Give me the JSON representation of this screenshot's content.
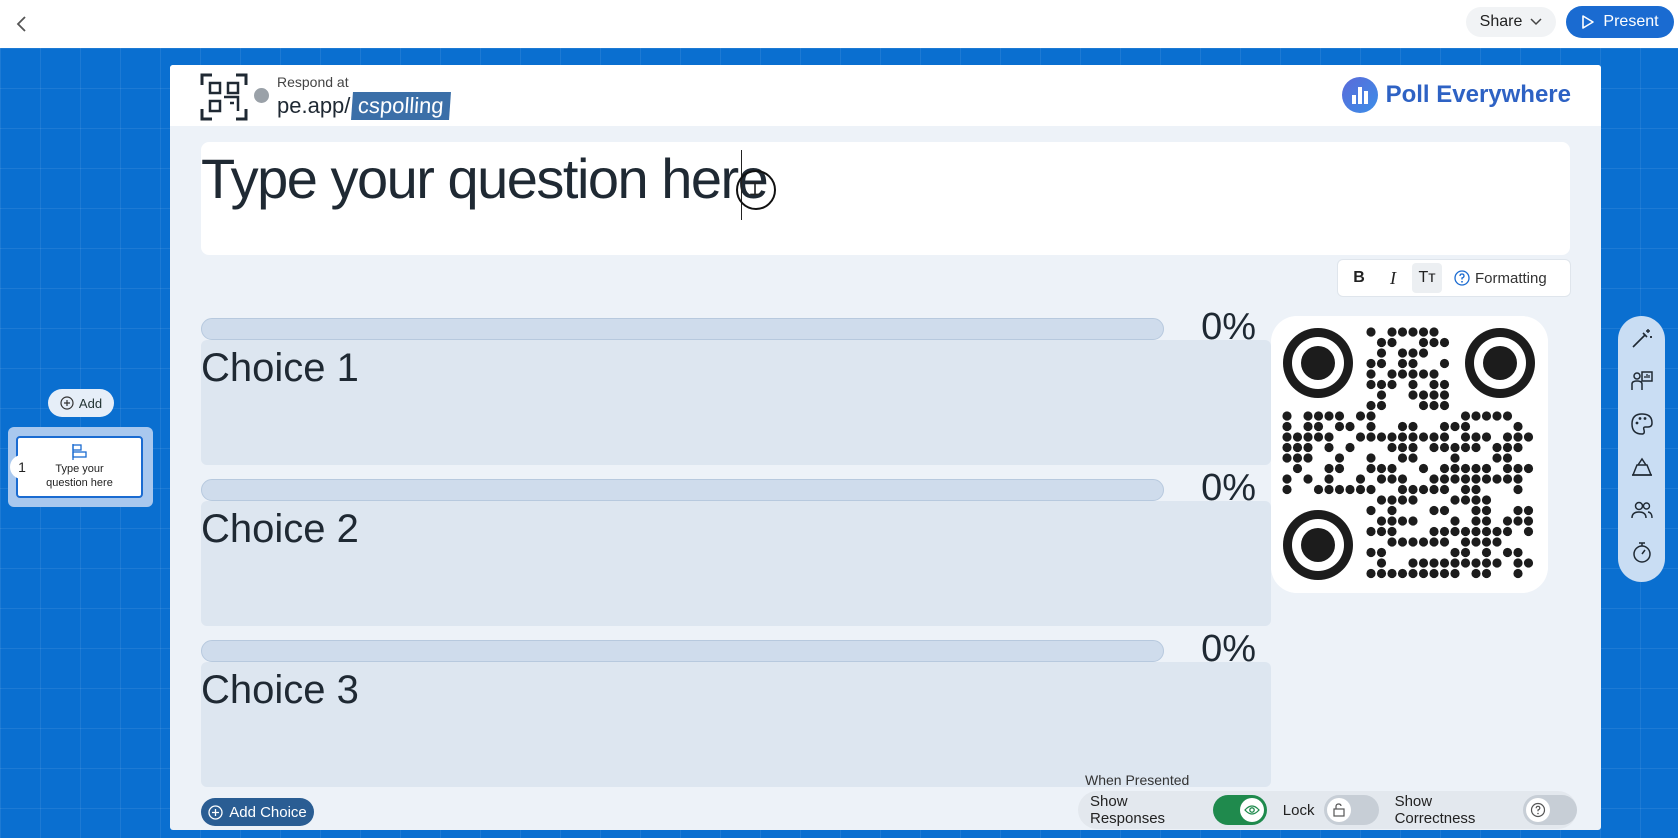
{
  "topbar": {
    "share_label": "Share",
    "present_label": "Present",
    "accent": "#1a6bd1"
  },
  "sidebar": {
    "add_label": "Add",
    "slides": [
      {
        "number": "1",
        "title": "Type your question here"
      }
    ]
  },
  "slide": {
    "respond_label": "Respond at",
    "respond_url_prefix": "pe.app/",
    "respond_code": "cspolling",
    "brand_name": "Poll Everywhere",
    "question_text": "Type your question here",
    "formatting": {
      "bold_label": "B",
      "italic_label": "I",
      "size_label": "Tт",
      "help_label": "Formatting"
    },
    "choices": [
      {
        "label": "Choice 1",
        "percent": "0%",
        "fraction": 0
      },
      {
        "label": "Choice 2",
        "percent": "0%",
        "fraction": 0
      },
      {
        "label": "Choice 3",
        "percent": "0%",
        "fraction": 0
      }
    ],
    "add_choice_label": "Add Choice",
    "when_presented": {
      "heading": "When Presented",
      "show_responses_label": "Show Responses",
      "show_responses_on": true,
      "lock_label": "Lock",
      "lock_on": false,
      "show_correctness_label": "Show Correctness",
      "show_correctness_on": false
    }
  },
  "tool_rail": [
    {
      "icon": "magic-wand-icon"
    },
    {
      "icon": "presenter-icon"
    },
    {
      "icon": "palette-icon"
    },
    {
      "icon": "audience-icon"
    },
    {
      "icon": "participants-icon"
    },
    {
      "icon": "timer-icon"
    }
  ]
}
